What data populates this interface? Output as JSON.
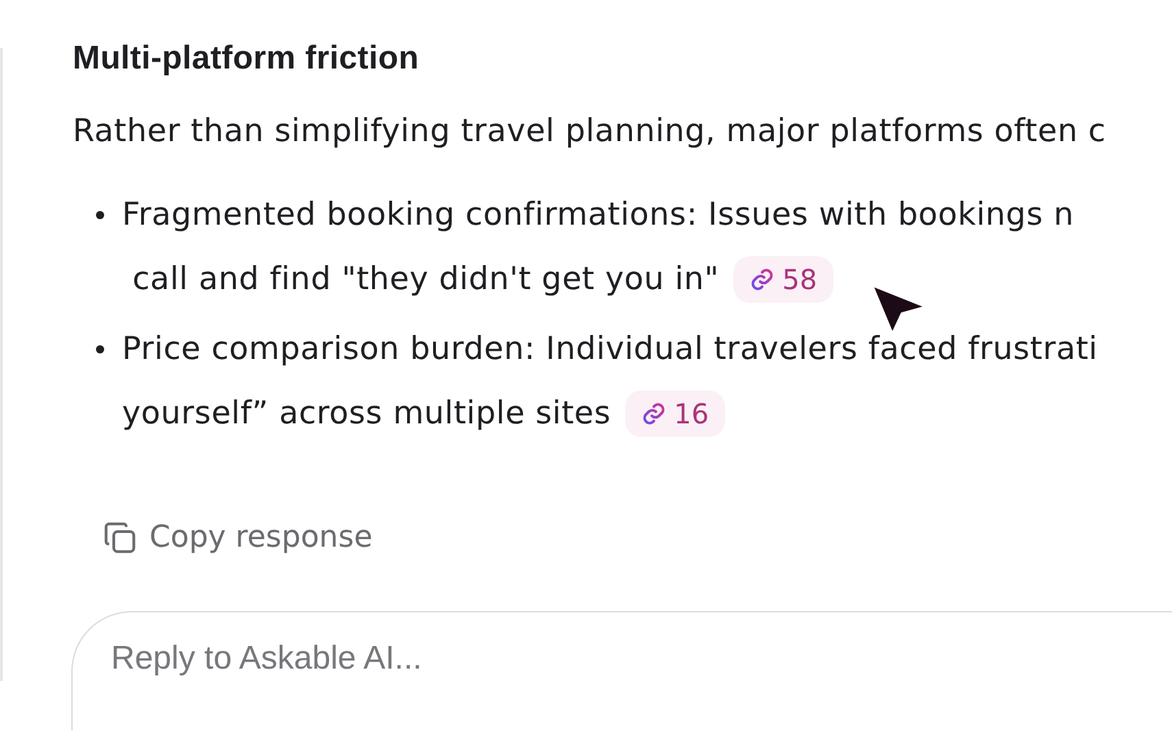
{
  "section": {
    "heading": "Multi-platform friction",
    "intro": "Rather than simplifying travel planning, major platforms often c",
    "bullets": [
      {
        "lines": [
          "Fragmented booking confirmations: Issues with bookings n",
          " call and find \"they didn't get you in\""
        ],
        "citation": "58"
      },
      {
        "lines": [
          "Price comparison burden: Individual travelers faced frustrati",
          "yourself” across multiple sites"
        ],
        "citation": "16"
      }
    ]
  },
  "copy_button": {
    "label": "Copy response"
  },
  "reply_box": {
    "placeholder": "Reply to Askable AI..."
  }
}
